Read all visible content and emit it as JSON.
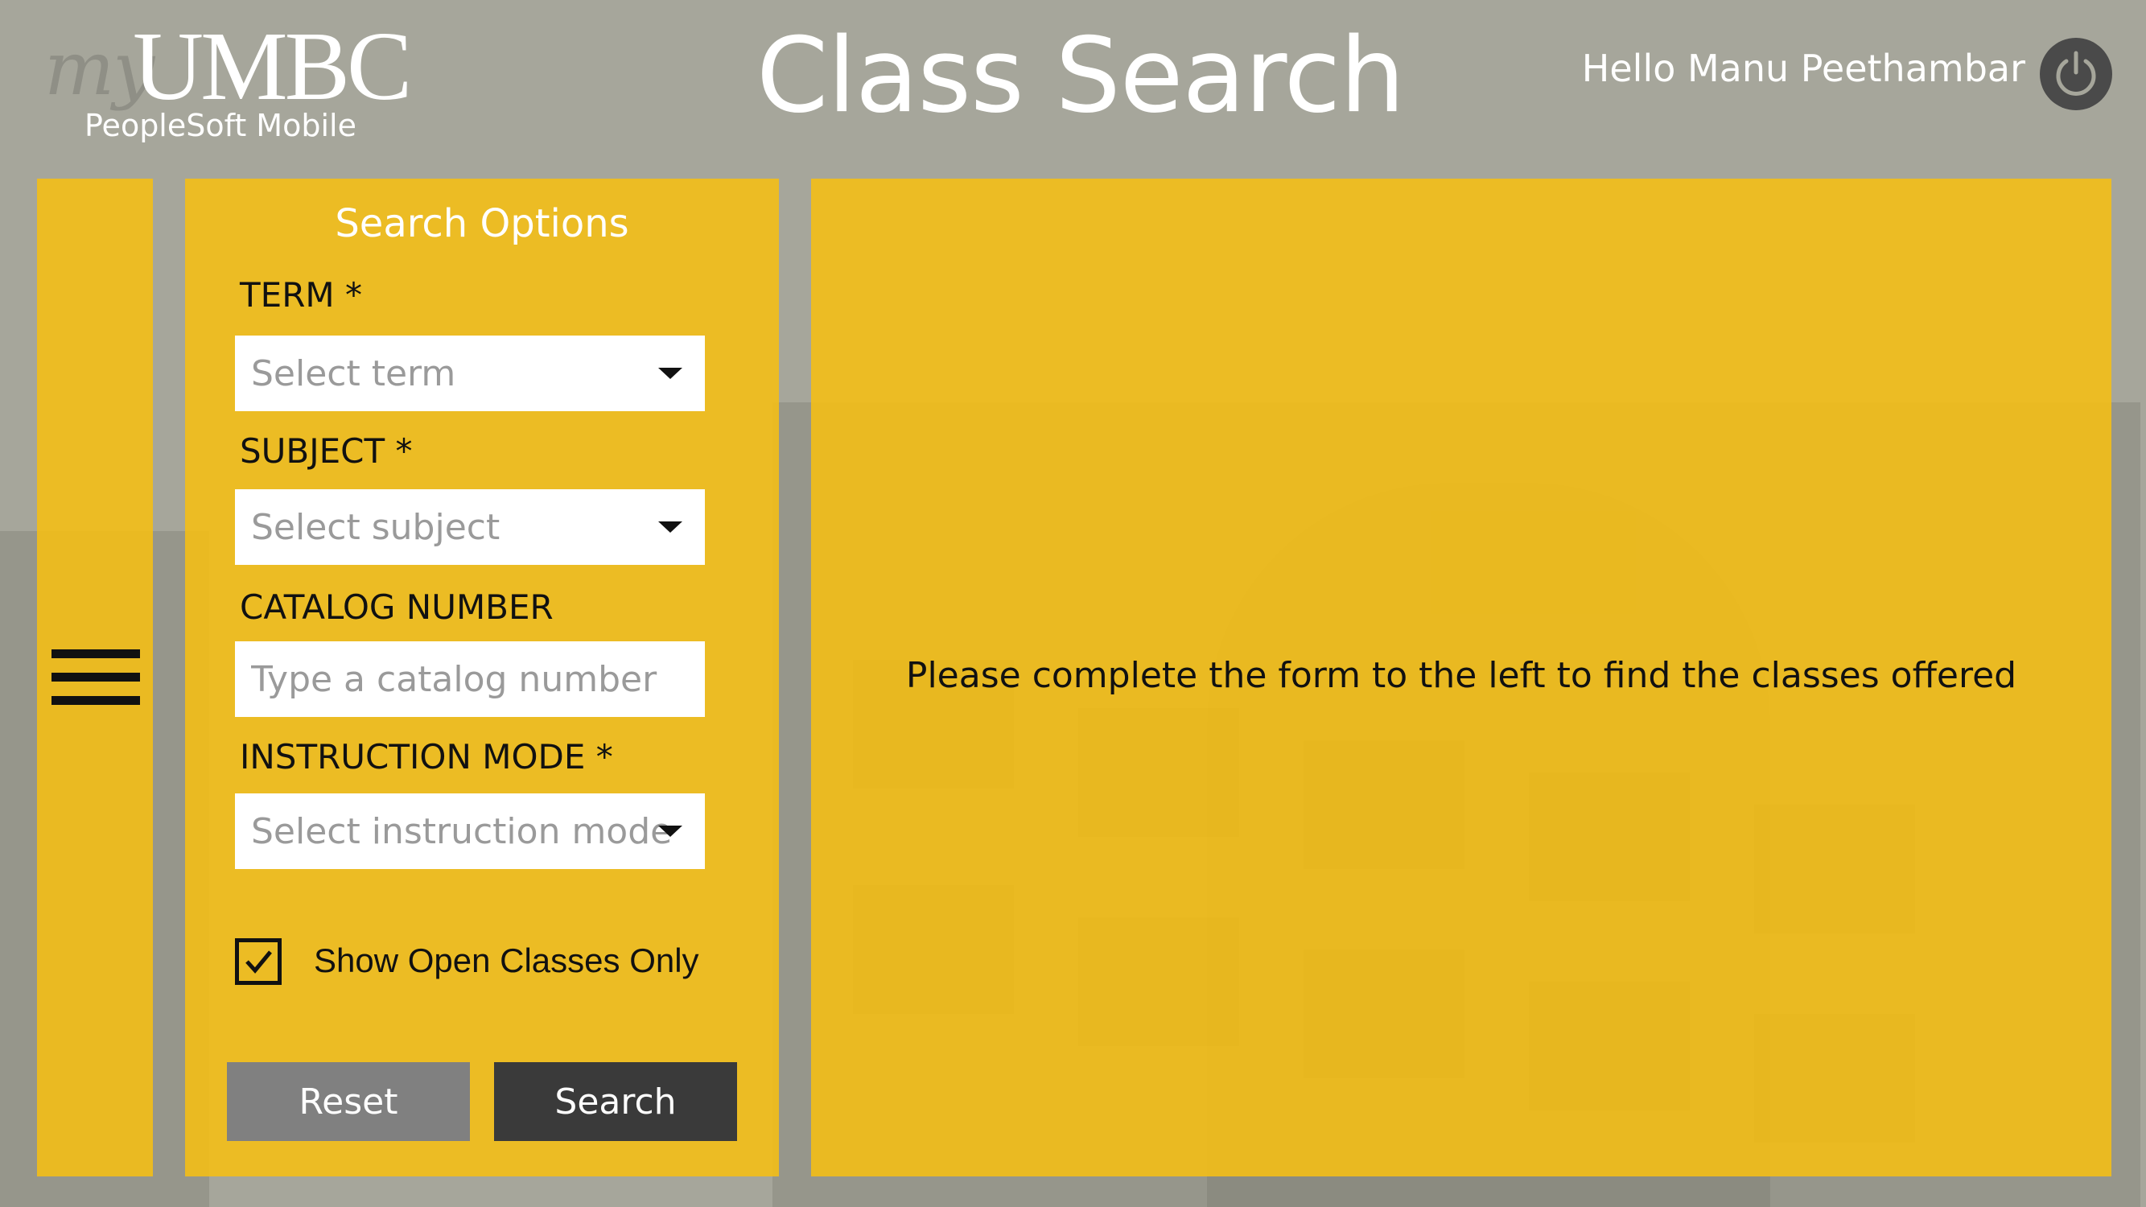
{
  "header": {
    "logo_my": "my",
    "logo_umbc": "UMBC",
    "logo_sub": "PeopleSoft Mobile",
    "title": "Class Search",
    "greeting": "Hello Manu Peethambar",
    "power_icon": "power-icon"
  },
  "sidebar": {
    "menu_icon": "hamburger-menu-icon"
  },
  "form": {
    "heading": "Search Options",
    "term_label": "TERM *",
    "term_placeholder": "Select term",
    "subject_label": "SUBJECT *",
    "subject_placeholder": "Select subject",
    "catalog_label": "CATALOG NUMBER",
    "catalog_placeholder": "Type a catalog number",
    "mode_label": "INSTRUCTION MODE *",
    "mode_placeholder": "Select instruction mode",
    "open_only_label": "Show Open Classes Only",
    "open_only_checked": true,
    "reset_label": "Reset",
    "search_label": "Search"
  },
  "results": {
    "message": "Please complete the form to the left to find the classes offered"
  },
  "colors": {
    "panel": "#f6bf13",
    "background": "#a6a69b",
    "reset_button": "#808080",
    "search_button": "#3a3a3a"
  }
}
